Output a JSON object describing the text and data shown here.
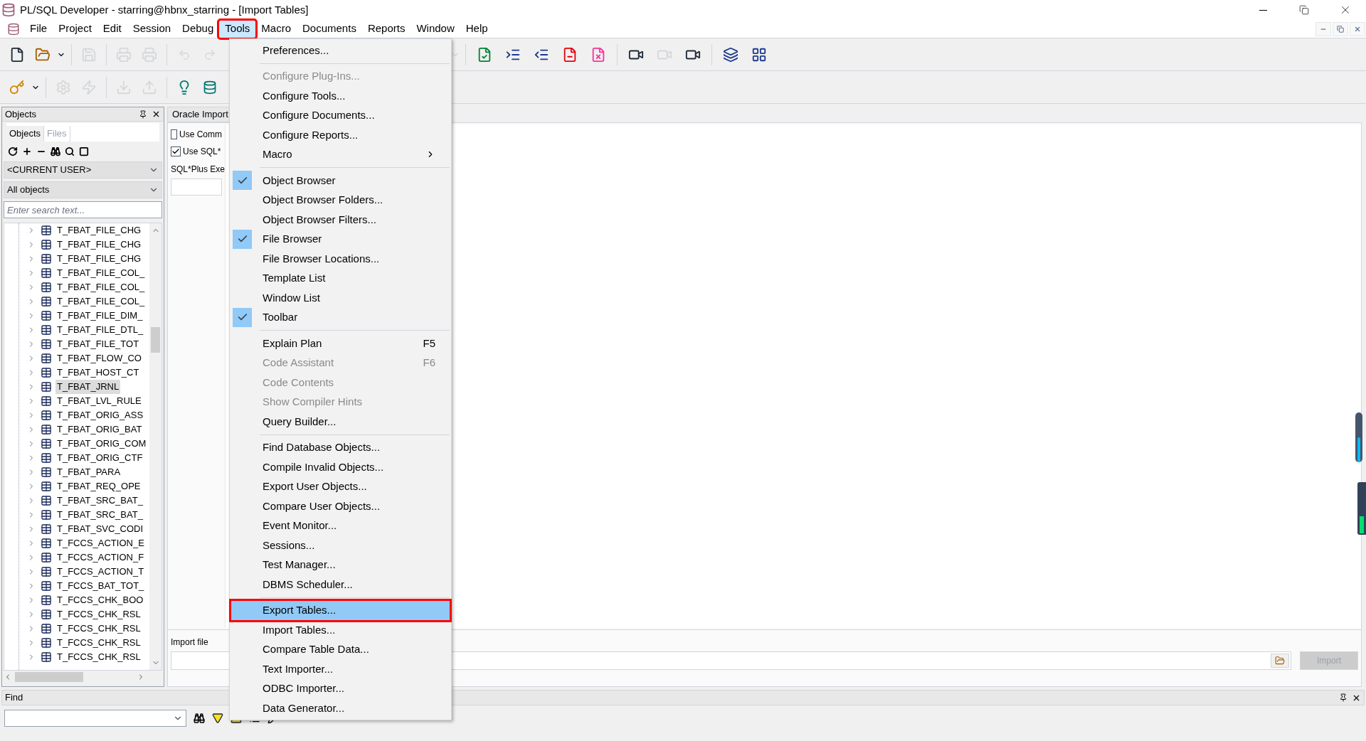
{
  "window": {
    "title": "PL/SQL Developer - starring@hbnx_starring - [Import Tables]"
  },
  "menubar": [
    {
      "label": "File",
      "selected": false,
      "marked": false
    },
    {
      "label": "Project",
      "selected": false,
      "marked": false
    },
    {
      "label": "Edit",
      "selected": false,
      "marked": false
    },
    {
      "label": "Session",
      "selected": false,
      "marked": false
    },
    {
      "label": "Debug",
      "selected": false,
      "marked": false
    },
    {
      "label": "Tools",
      "selected": true,
      "marked": true
    },
    {
      "label": "Macro",
      "selected": false,
      "marked": false
    },
    {
      "label": "Documents",
      "selected": false,
      "marked": false
    },
    {
      "label": "Reports",
      "selected": false,
      "marked": false
    },
    {
      "label": "Window",
      "selected": false,
      "marked": false
    },
    {
      "label": "Help",
      "selected": false,
      "marked": false
    }
  ],
  "toolbar_1": {
    "left": [
      [
        {
          "kind": "new",
          "disabled": false
        },
        {
          "kind": "open",
          "disabled": false
        },
        {
          "kind": "caret",
          "disabled": false
        }
      ],
      [
        {
          "kind": "save",
          "disabled": true
        }
      ],
      [
        {
          "kind": "print",
          "disabled": true
        },
        {
          "kind": "preview",
          "disabled": true
        }
      ],
      [
        {
          "kind": "undo",
          "disabled": true
        },
        {
          "kind": "redo",
          "disabled": true
        }
      ]
    ],
    "right": [
      [
        {
          "kind": "caret",
          "disabled": true
        }
      ],
      [
        {
          "kind": "check-doc",
          "disabled": false
        },
        {
          "kind": "indent",
          "disabled": false
        },
        {
          "kind": "outdent",
          "disabled": false
        },
        {
          "kind": "red-doc",
          "disabled": false
        },
        {
          "kind": "pink-doc",
          "disabled": false
        }
      ],
      [
        {
          "kind": "record",
          "disabled": false
        },
        {
          "kind": "play",
          "disabled": true
        },
        {
          "kind": "macro",
          "disabled": false
        }
      ],
      [
        {
          "kind": "cascade",
          "disabled": false
        },
        {
          "kind": "tile",
          "disabled": false
        }
      ]
    ]
  },
  "toolbar_2": [
    [
      {
        "kind": "key",
        "disabled": false
      },
      {
        "kind": "caret",
        "disabled": false
      }
    ],
    [
      {
        "kind": "gear",
        "disabled": true
      },
      {
        "kind": "bolt",
        "disabled": true
      }
    ],
    [
      {
        "kind": "download",
        "disabled": true
      },
      {
        "kind": "upload",
        "disabled": true
      }
    ],
    [
      {
        "kind": "db-bulb",
        "disabled": false
      },
      {
        "kind": "db-sql",
        "disabled": false
      }
    ]
  ],
  "objects_panel": {
    "title": "Objects",
    "tabs": [
      {
        "label": "Objects",
        "selected": true
      },
      {
        "label": "Files",
        "selected": false
      }
    ],
    "user_select": "<CURRENT USER>",
    "filter_select": "All objects",
    "search": {
      "placeholder": "Enter search text..."
    },
    "rows": [
      {
        "label": "T_FBAT_FILE_CHG",
        "selected": false
      },
      {
        "label": "T_FBAT_FILE_CHG",
        "selected": false
      },
      {
        "label": "T_FBAT_FILE_CHG",
        "selected": false
      },
      {
        "label": "T_FBAT_FILE_COL_",
        "selected": false
      },
      {
        "label": "T_FBAT_FILE_COL_",
        "selected": false
      },
      {
        "label": "T_FBAT_FILE_COL_",
        "selected": false
      },
      {
        "label": "T_FBAT_FILE_DIM_",
        "selected": false
      },
      {
        "label": "T_FBAT_FILE_DTL_",
        "selected": false
      },
      {
        "label": "T_FBAT_FILE_TOT",
        "selected": false
      },
      {
        "label": "T_FBAT_FLOW_CO",
        "selected": false
      },
      {
        "label": "T_FBAT_HOST_CT",
        "selected": false
      },
      {
        "label": "T_FBAT_JRNL",
        "selected": true
      },
      {
        "label": "T_FBAT_LVL_RULE",
        "selected": false
      },
      {
        "label": "T_FBAT_ORIG_ASS",
        "selected": false
      },
      {
        "label": "T_FBAT_ORIG_BAT",
        "selected": false
      },
      {
        "label": "T_FBAT_ORIG_COM",
        "selected": false
      },
      {
        "label": "T_FBAT_ORIG_CTF",
        "selected": false
      },
      {
        "label": "T_FBAT_PARA",
        "selected": false
      },
      {
        "label": "T_FBAT_REQ_OPE",
        "selected": false
      },
      {
        "label": "T_FBAT_SRC_BAT_",
        "selected": false
      },
      {
        "label": "T_FBAT_SRC_BAT_",
        "selected": false
      },
      {
        "label": "T_FBAT_SVC_CODI",
        "selected": false
      },
      {
        "label": "T_FCCS_ACTION_E",
        "selected": false
      },
      {
        "label": "T_FCCS_ACTION_F",
        "selected": false
      },
      {
        "label": "T_FCCS_ACTION_T",
        "selected": false
      },
      {
        "label": "T_FCCS_BAT_TOT_",
        "selected": false
      },
      {
        "label": "T_FCCS_CHK_BOO",
        "selected": false
      },
      {
        "label": "T_FCCS_CHK_RSL",
        "selected": false
      },
      {
        "label": "T_FCCS_CHK_RSL",
        "selected": false
      },
      {
        "label": "T_FCCS_CHK_RSL",
        "selected": false
      },
      {
        "label": "T_FCCS_CHK_RSL",
        "selected": false
      }
    ]
  },
  "import_window": {
    "tab": "Oracle Import",
    "options": [
      {
        "label": "Use Comm",
        "checked": false
      },
      {
        "label": "Use SQL*",
        "checked": true
      }
    ],
    "exe_label": "SQL*Plus Exe",
    "import_file_label": "Import file",
    "import_button": {
      "label": "Import",
      "disabled": true
    }
  },
  "find_panel": {
    "title": "Find"
  },
  "tools_menu": [
    [
      {
        "label": "Preferences...",
        "checked": false,
        "disabled": false,
        "submenu": false,
        "selected": false,
        "marked": false
      }
    ],
    [
      {
        "label": "Configure Plug-Ins...",
        "checked": false,
        "disabled": true,
        "submenu": false,
        "selected": false,
        "marked": false
      },
      {
        "label": "Configure Tools...",
        "checked": false,
        "disabled": false,
        "submenu": false,
        "selected": false,
        "marked": false
      },
      {
        "label": "Configure Documents...",
        "checked": false,
        "disabled": false,
        "submenu": false,
        "selected": false,
        "marked": false
      },
      {
        "label": "Configure Reports...",
        "checked": false,
        "disabled": false,
        "submenu": false,
        "selected": false,
        "marked": false
      },
      {
        "label": "Macro",
        "checked": false,
        "disabled": false,
        "submenu": true,
        "selected": false,
        "marked": false
      }
    ],
    [
      {
        "label": "Object Browser",
        "checked": true,
        "disabled": false,
        "submenu": false,
        "selected": false,
        "marked": false
      },
      {
        "label": "Object Browser Folders...",
        "checked": false,
        "disabled": false,
        "submenu": false,
        "selected": false,
        "marked": false
      },
      {
        "label": "Object Browser Filters...",
        "checked": false,
        "disabled": false,
        "submenu": false,
        "selected": false,
        "marked": false
      },
      {
        "label": "File Browser",
        "checked": true,
        "disabled": false,
        "submenu": false,
        "selected": false,
        "marked": false
      },
      {
        "label": "File Browser Locations...",
        "checked": false,
        "disabled": false,
        "submenu": false,
        "selected": false,
        "marked": false
      },
      {
        "label": "Template List",
        "checked": false,
        "disabled": false,
        "submenu": false,
        "selected": false,
        "marked": false
      },
      {
        "label": "Window List",
        "checked": false,
        "disabled": false,
        "submenu": false,
        "selected": false,
        "marked": false
      },
      {
        "label": "Toolbar",
        "checked": true,
        "disabled": false,
        "submenu": false,
        "selected": false,
        "marked": false
      }
    ],
    [
      {
        "label": "Explain Plan",
        "shortcut": "F5",
        "checked": false,
        "disabled": false,
        "submenu": false,
        "selected": false,
        "marked": false
      },
      {
        "label": "Code Assistant",
        "shortcut": "F6",
        "checked": false,
        "disabled": true,
        "submenu": false,
        "selected": false,
        "marked": false
      },
      {
        "label": "Code Contents",
        "checked": false,
        "disabled": true,
        "submenu": false,
        "selected": false,
        "marked": false
      },
      {
        "label": "Show Compiler Hints",
        "checked": false,
        "disabled": true,
        "submenu": false,
        "selected": false,
        "marked": false
      },
      {
        "label": "Query Builder...",
        "checked": false,
        "disabled": false,
        "submenu": false,
        "selected": false,
        "marked": false
      }
    ],
    [
      {
        "label": "Find Database Objects...",
        "checked": false,
        "disabled": false,
        "submenu": false,
        "selected": false,
        "marked": false
      },
      {
        "label": "Compile Invalid Objects...",
        "checked": false,
        "disabled": false,
        "submenu": false,
        "selected": false,
        "marked": false
      },
      {
        "label": "Export User Objects...",
        "checked": false,
        "disabled": false,
        "submenu": false,
        "selected": false,
        "marked": false
      },
      {
        "label": "Compare User Objects...",
        "checked": false,
        "disabled": false,
        "submenu": false,
        "selected": false,
        "marked": false
      },
      {
        "label": "Event Monitor...",
        "checked": false,
        "disabled": false,
        "submenu": false,
        "selected": false,
        "marked": false
      },
      {
        "label": "Sessions...",
        "checked": false,
        "disabled": false,
        "submenu": false,
        "selected": false,
        "marked": false
      },
      {
        "label": "Test Manager...",
        "checked": false,
        "disabled": false,
        "submenu": false,
        "selected": false,
        "marked": false
      },
      {
        "label": "DBMS Scheduler...",
        "checked": false,
        "disabled": false,
        "submenu": false,
        "selected": false,
        "marked": false
      }
    ],
    [
      {
        "label": "Export Tables...",
        "checked": false,
        "disabled": false,
        "submenu": false,
        "selected": true,
        "marked": true
      },
      {
        "label": "Import Tables...",
        "checked": false,
        "disabled": false,
        "submenu": false,
        "selected": false,
        "marked": false
      },
      {
        "label": "Compare Table Data...",
        "checked": false,
        "disabled": false,
        "submenu": false,
        "selected": false,
        "marked": false
      },
      {
        "label": "Text Importer...",
        "checked": false,
        "disabled": false,
        "submenu": false,
        "selected": false,
        "marked": false
      },
      {
        "label": "ODBC Importer...",
        "checked": false,
        "disabled": false,
        "submenu": false,
        "selected": false,
        "marked": false
      },
      {
        "label": "Data Generator...",
        "checked": false,
        "disabled": false,
        "submenu": false,
        "selected": false,
        "marked": false
      }
    ]
  ],
  "side_slider": {
    "level": 0.5
  },
  "level_meter": {
    "level": 0.35
  }
}
